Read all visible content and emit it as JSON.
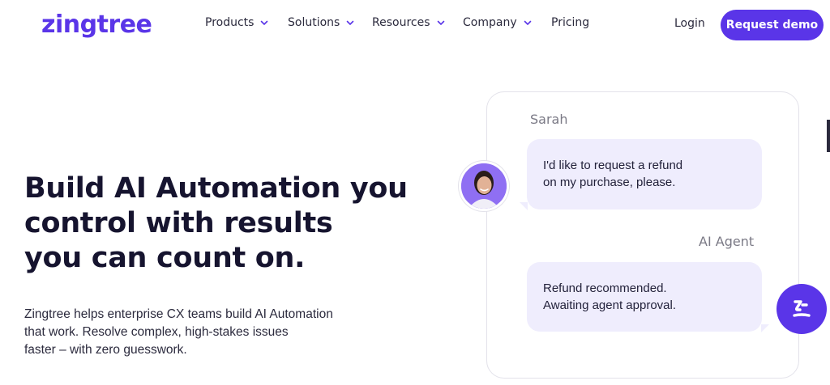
{
  "header": {
    "logo_text": "zingtree",
    "nav": [
      {
        "label": "Products",
        "has_dropdown": true
      },
      {
        "label": "Solutions",
        "has_dropdown": true
      },
      {
        "label": "Resources",
        "has_dropdown": true
      },
      {
        "label": "Company",
        "has_dropdown": true
      },
      {
        "label": "Pricing",
        "has_dropdown": false
      }
    ],
    "login_label": "Login",
    "cta_label": "Request demo"
  },
  "hero": {
    "headline_lines": [
      "Build AI Automation you",
      "control with results",
      "you can count on."
    ],
    "subtext_lines": [
      "Zingtree helps enterprise CX teams build AI Automation",
      "that work. Resolve complex, high-stakes issues",
      "faster – with zero guesswork."
    ]
  },
  "chat": {
    "user_name": "Sarah",
    "user_message_lines": [
      "I'd like to request a refund",
      "on my purchase, please."
    ],
    "agent_name": "AI Agent",
    "agent_message_lines": [
      "Refund recommended.",
      "Awaiting agent approval."
    ]
  },
  "icons": {
    "nav_dropdown": "chevron-down-icon",
    "user_avatar": "avatar-photo",
    "agent_badge": "zingtree-agent-icon"
  },
  "colors": {
    "brand": "#5a35e8",
    "bubble": "#efedfd",
    "text_dark": "#16142f",
    "muted": "#7b7a86"
  }
}
